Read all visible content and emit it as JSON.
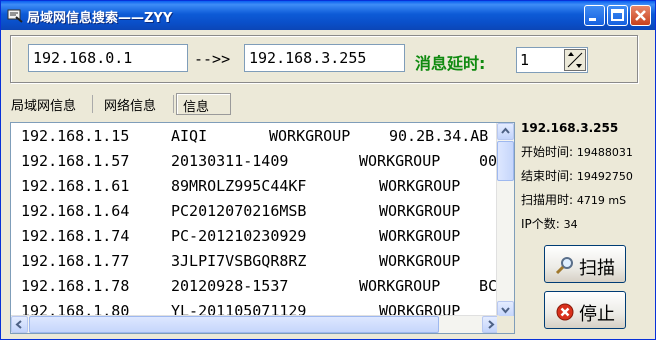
{
  "window": {
    "title": "局域网信息搜索——ZYY"
  },
  "range": {
    "start_ip": "192.168.0.1",
    "arrow": "-->>",
    "end_ip": "192.168.3.255"
  },
  "delay": {
    "label": "消息延时:",
    "value": "1"
  },
  "tabs": [
    {
      "label": "局域网信息"
    },
    {
      "label": "网络信息"
    },
    {
      "label": "信息",
      "active": true
    }
  ],
  "results": [
    {
      "ip": "192.168.1.15",
      "name": "AIQI",
      "group": "WORKGROUP",
      "mac": "90.2B.34.AB"
    },
    {
      "ip": "192.168.1.57",
      "name": "20130311-1409",
      "group": "WORKGROUP",
      "mac": "00"
    },
    {
      "ip": "192.168.1.61",
      "name": "89MROLZ995C44KF",
      "group": "WORKGROUP",
      "mac": ""
    },
    {
      "ip": "192.168.1.64",
      "name": "PC2012070216MSB",
      "group": "WORKGROUP",
      "mac": ""
    },
    {
      "ip": "192.168.1.74",
      "name": "PC-201210230929",
      "group": "WORKGROUP",
      "mac": ""
    },
    {
      "ip": "192.168.1.77",
      "name": "3JLPI7VSBGQR8RZ",
      "group": "WORKGROUP",
      "mac": ""
    },
    {
      "ip": "192.168.1.78",
      "name": "20120928-1537",
      "group": "WORKGROUP",
      "mac": "BC"
    },
    {
      "ip": "192.168.1.80",
      "name": "YL-201105071129",
      "group": "WORKGROUP",
      "mac": ""
    }
  ],
  "status": {
    "current_ip": "192.168.3.255",
    "start_label": "开始时间:",
    "start_value": "19488031",
    "end_label": "结束时间:",
    "end_value": "19492750",
    "elapsed_label": "扫描用时:",
    "elapsed_value": "4719 mS",
    "ipcount_label": "IP个数:",
    "ipcount_value": "34"
  },
  "buttons": {
    "scan": "扫描",
    "stop": "停止"
  },
  "icons": [
    "app-icon",
    "minimize-icon",
    "maximize-icon",
    "close-icon",
    "magnifier-icon",
    "stop-icon",
    "spin-arrows-icon"
  ]
}
